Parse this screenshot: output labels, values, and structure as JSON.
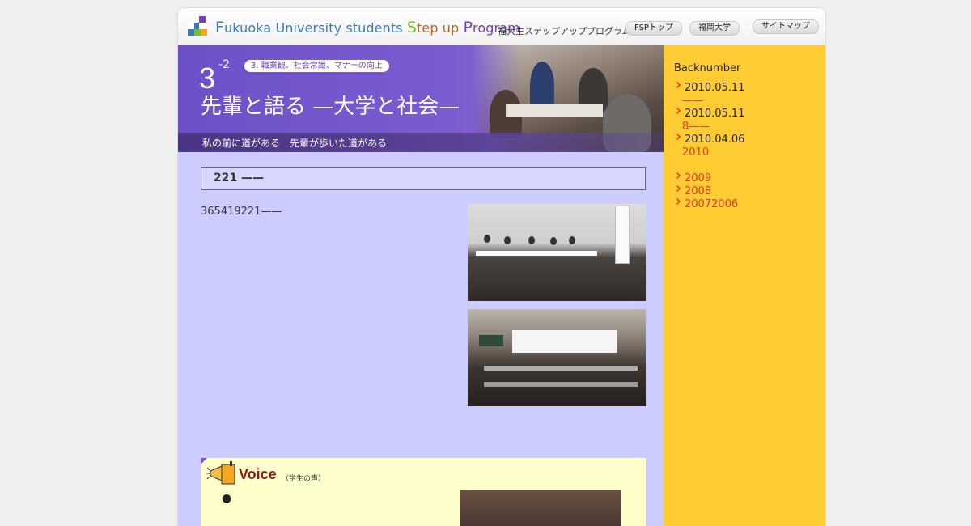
{
  "header": {
    "logo_segments": [
      {
        "cls": "hl-f",
        "text": "F"
      },
      {
        "cls": "plain",
        "text": "ukuoka University students "
      },
      {
        "cls": "hl-s",
        "text": "S"
      },
      {
        "cls": "rest2",
        "text": "tep up "
      },
      {
        "cls": "hl-p",
        "text": "P"
      },
      {
        "cls": "rest",
        "text": "rogram"
      }
    ],
    "jp_title": "福大生ステップアッププログラム",
    "nav": [
      {
        "label": "FSPトップ"
      },
      {
        "label": "福岡大学"
      },
      {
        "label": "サイトマップ"
      }
    ],
    "logo_colors": [
      "#7a3fb5",
      "#3a7ab8",
      "#7bbf2a",
      "#f5a623"
    ]
  },
  "banner": {
    "number": "3",
    "superscript": "-2",
    "tag": "3. 職業観、社会常識、マナーの向上",
    "title": "先輩と語る —大学と社会—",
    "subtitle": "私の前に道がある　先輩が歩いた道がある"
  },
  "main": {
    "section_heading": "221 ——",
    "body_text": "365419221——",
    "photos": [
      {
        "name": "panel-discussion-photo-1",
        "alt": ""
      },
      {
        "name": "panel-discussion-photo-2",
        "alt": ""
      }
    ]
  },
  "voice": {
    "title": "Voice",
    "subtitle": "（学生の声）",
    "bullet": "●"
  },
  "sidebar": {
    "title": "Backnumber",
    "items": [
      {
        "date": "2010.05.11",
        "sub": "——"
      },
      {
        "date": "2010.05.11",
        "sub": "8——"
      },
      {
        "date": "2010.04.06",
        "sub": "2010"
      }
    ],
    "years": [
      "2009",
      "2008",
      "20072006"
    ]
  },
  "colors": {
    "banner_purple": "#7b5bd0",
    "content_bg": "#ccccff",
    "sidebar_bg": "#ffcc33",
    "link_red": "#d93a17",
    "voice_bg": "#ffffcc"
  }
}
